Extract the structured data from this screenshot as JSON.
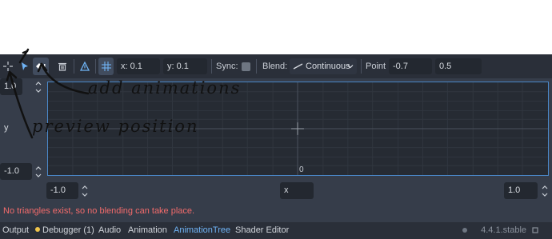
{
  "toolbar": {
    "icons": [
      "crosshair-icon",
      "pointer-select-icon",
      "add-point-icon",
      "trash-icon",
      "triangle-icon",
      "grid-snap-icon"
    ],
    "x_field": "x: 0.1",
    "y_field": "y: 0.1",
    "sync_label": "Sync:",
    "blend_label": "Blend:",
    "blend_value": "Continuous",
    "point_label": "Point",
    "point_x": "-0.7",
    "point_y": "0.5"
  },
  "plot": {
    "y_max": "1.0",
    "y_label": "y",
    "y_min": "-1.0",
    "origin_label": "0",
    "x_min": "-1.0",
    "x_label": "x",
    "x_max": "1.0"
  },
  "status": {
    "message": "No triangles exist, so no blending can take place."
  },
  "bottom_panel": {
    "tabs": [
      "Output",
      "Debugger (1)",
      "Audio",
      "Animation",
      "AnimationTree",
      "Shader Editor"
    ],
    "active_tab": "AnimationTree",
    "version": "4.4.1.stable"
  },
  "annotations": {
    "add_animations": "add animations",
    "preview_position": "preview position"
  },
  "colors": {
    "panel_bg": "#363d4a",
    "toolbar_bg": "#2a2f39",
    "plot_bg": "#262b33",
    "accent": "#4a87c8",
    "error_text": "#f36b6b",
    "active_tab": "#6fb3f5"
  }
}
